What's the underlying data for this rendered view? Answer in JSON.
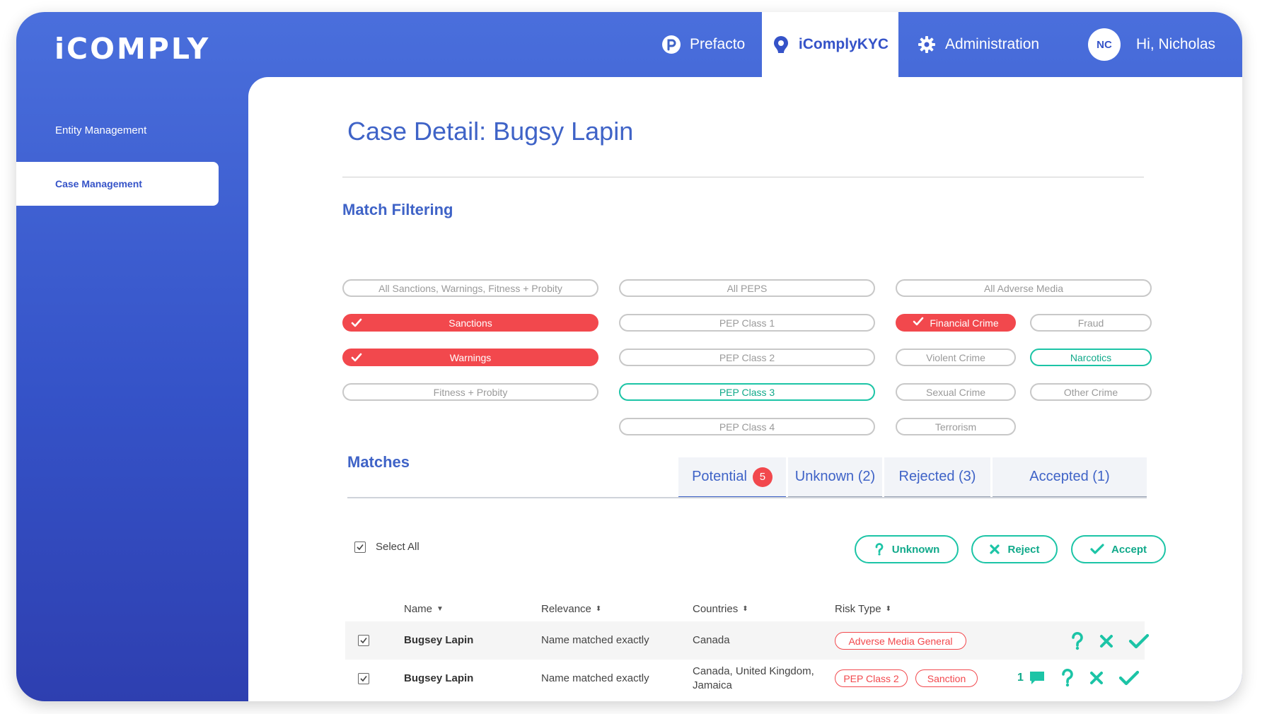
{
  "app": {
    "logo": "iCOMPLY"
  },
  "topnav": {
    "prefacto": "Prefacto",
    "icomplykyc": "iComplyKYC",
    "administration": "Administration",
    "avatar_initials": "NC",
    "greeting": "Hi, Nicholas"
  },
  "sidebar": {
    "items": [
      {
        "label": "Entity Management",
        "active": false
      },
      {
        "label": "Case Management",
        "active": true
      }
    ]
  },
  "page": {
    "title": "Case Detail: Bugsy Lapin"
  },
  "filters": {
    "title": "Match Filtering",
    "column1": [
      {
        "label": "All Sanctions, Warnings, Fitness + Probity",
        "state": "off"
      },
      {
        "label": "Sanctions",
        "state": "checked"
      },
      {
        "label": "Warnings",
        "state": "checked"
      },
      {
        "label": "Fitness + Probity",
        "state": "off"
      }
    ],
    "column2": [
      {
        "label": "All PEPS",
        "state": "off"
      },
      {
        "label": "PEP Class 1",
        "state": "off"
      },
      {
        "label": "PEP Class 2",
        "state": "off"
      },
      {
        "label": "PEP Class 3",
        "state": "highlight"
      },
      {
        "label": "PEP Class 4",
        "state": "off"
      }
    ],
    "column3": [
      {
        "label": "All Adverse Media",
        "state": "off"
      },
      {
        "label": "Financial Crime",
        "state": "checked"
      },
      {
        "label": "Fraud",
        "state": "off"
      },
      {
        "label": "Violent Crime",
        "state": "off"
      },
      {
        "label": "Narcotics",
        "state": "highlight"
      },
      {
        "label": "Sexual Crime",
        "state": "off"
      },
      {
        "label": "Other Crime",
        "state": "off"
      },
      {
        "label": "Terrorism",
        "state": "off"
      }
    ]
  },
  "matches": {
    "title": "Matches",
    "tabs": [
      {
        "label": "Potential",
        "badge": "5",
        "active": true
      },
      {
        "label": "Unknown (2)",
        "active": false
      },
      {
        "label": "Rejected (3)",
        "active": false
      },
      {
        "label": "Accepted (1)",
        "active": false
      }
    ],
    "select_all": "Select All",
    "actions": {
      "unknown": "Unknown",
      "reject": "Reject",
      "accept": "Accept"
    },
    "columns": {
      "name": "Name",
      "relevance": "Relevance",
      "countries": "Countries",
      "risk_type": "Risk Type"
    },
    "rows": [
      {
        "name": "Bugsey Lapin",
        "relevance": "Name matched exactly",
        "countries_line1": "Canada",
        "countries_line2": "",
        "risks": [
          "Adverse Media General"
        ],
        "comments": ""
      },
      {
        "name": "Bugsey Lapin",
        "relevance": "Name matched exactly",
        "countries_line1": "Canada, United Kingdom,",
        "countries_line2": "Jamaica",
        "risks": [
          "PEP Class 2",
          "Sanction"
        ],
        "comments": "1"
      }
    ]
  },
  "colors": {
    "primary_blue": "#3553c8",
    "accent_red": "#f2484d",
    "accent_teal": "#1cc4a6"
  }
}
